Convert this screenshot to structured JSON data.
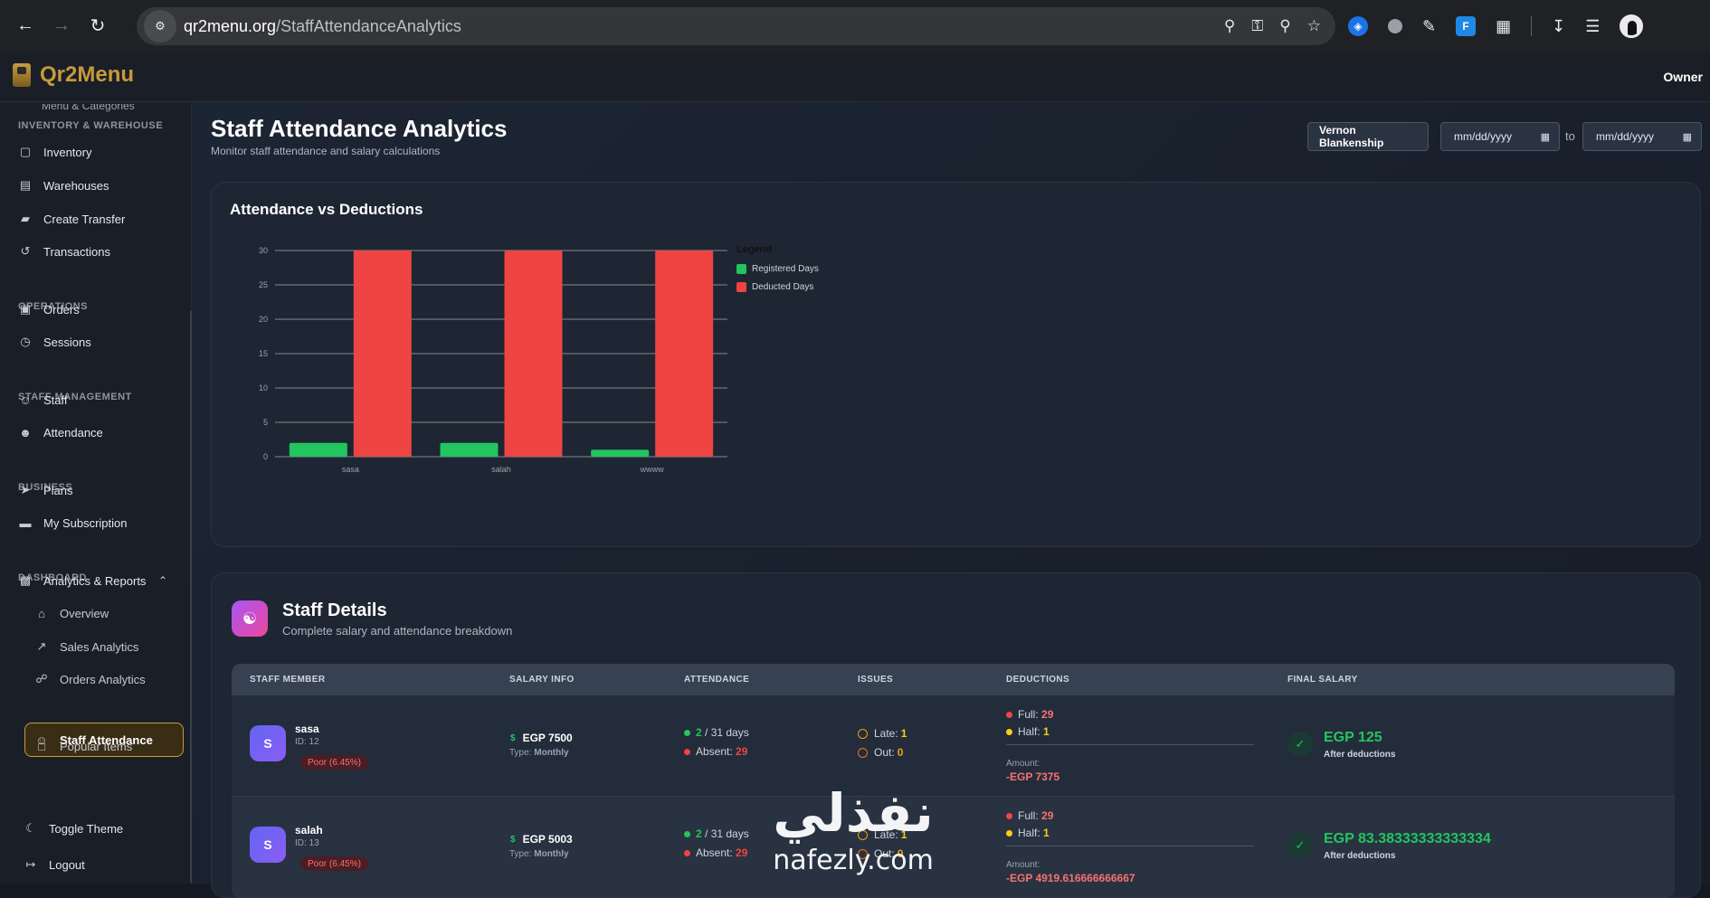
{
  "browser": {
    "url_host": "qr2menu.org",
    "url_path": "/StaffAttendanceAnalytics",
    "nav_icons": [
      "back-icon",
      "forward-icon",
      "reload-icon"
    ],
    "url_right_icons": [
      "location-icon",
      "key-icon",
      "zoom-icon",
      "star-icon"
    ],
    "extension_icons": [
      "tampermonkey-icon",
      "grey-extension-icon",
      "eyedropper-icon",
      "fl-extension-icon",
      "puzzle-icon",
      "download-icon",
      "media-queue-icon",
      "profile-avatar"
    ]
  },
  "app": {
    "brand": "Qr2Menu",
    "user": "Owner"
  },
  "sidebar": {
    "cut_item": "Menu & Categories",
    "sections": {
      "inventory": "INVENTORY & WAREHOUSE",
      "operations": "OPERATIONS",
      "staff": "STAFF MANAGEMENT",
      "business": "BUSINESS",
      "dashboard": "DASHBOARD"
    },
    "items": {
      "inventory": "Inventory",
      "warehouses": "Warehouses",
      "create_transfer": "Create Transfer",
      "transactions": "Transactions",
      "orders": "Orders",
      "sessions": "Sessions",
      "staff": "Staff",
      "attendance": "Attendance",
      "plans": "Plans",
      "my_subscription": "My Subscription",
      "analytics_reports": "Analytics & Reports"
    },
    "sub_items": {
      "overview": "Overview",
      "sales_analytics": "Sales Analytics",
      "orders_analytics": "Orders Analytics",
      "staff_attendance": "Staff Attendance",
      "popular_items": "Popular Items"
    },
    "toggle_theme": "Toggle Theme",
    "logout": "Logout"
  },
  "page": {
    "title": "Staff Attendance Analytics",
    "subtitle": "Monitor staff attendance and salary calculations",
    "staff_filter": "Vernon Blankenship",
    "date_from_placeholder": "mm/dd/yyyy",
    "date_to_placeholder": "mm/dd/yyyy",
    "to_label": "to"
  },
  "chart_card": {
    "title": "Attendance vs Deductions",
    "legend_title": "Legend"
  },
  "chart_data": {
    "type": "bar",
    "categories": [
      "sasa",
      "salah",
      "wwww"
    ],
    "series": [
      {
        "name": "Registered Days",
        "values": [
          2,
          2,
          1
        ],
        "color": "#22c55e"
      },
      {
        "name": "Deducted Days",
        "values": [
          30,
          30,
          30
        ],
        "color": "#ef4444"
      }
    ],
    "ylim": [
      0,
      30
    ],
    "yticks": [
      "0",
      "5",
      "10",
      "15",
      "20",
      "25",
      "30"
    ],
    "grid": true,
    "legend_position": "right"
  },
  "staff_details": {
    "title": "Staff Details",
    "subtitle": "Complete salary and attendance breakdown",
    "columns": [
      "STAFF MEMBER",
      "SALARY INFO",
      "ATTENDANCE",
      "ISSUES",
      "DEDUCTIONS",
      "FINAL SALARY"
    ],
    "rows": [
      {
        "initial": "S",
        "name": "sasa",
        "id": "ID: 12",
        "rating": "Poor (6.45%)",
        "salary": "EGP 7500",
        "type_label": "Type:",
        "type": "Monthly",
        "present": "2",
        "days_total": "/ 31 days",
        "absent_label": "Absent:",
        "absent": "29",
        "late_label": "Late:",
        "late": "1",
        "out_label": "Out:",
        "out": "0",
        "full_label": "Full:",
        "full": "29",
        "half_label": "Half:",
        "half": "1",
        "amount_label": "Amount:",
        "amount": "-EGP 7375",
        "final": "EGP 125",
        "final_sub": "After deductions"
      },
      {
        "initial": "S",
        "name": "salah",
        "id": "ID: 13",
        "rating": "Poor (6.45%)",
        "salary": "EGP 5003",
        "type_label": "Type:",
        "type": "Monthly",
        "present": "2",
        "days_total": "/ 31 days",
        "absent_label": "Absent:",
        "absent": "29",
        "late_label": "Late:",
        "late": "1",
        "out_label": "Out:",
        "out": "0",
        "full_label": "Full:",
        "full": "29",
        "half_label": "Half:",
        "half": "1",
        "amount_label": "Amount:",
        "amount": "-EGP 4919.616666666667",
        "final": "EGP 83.38333333333334",
        "final_sub": "After deductions"
      }
    ]
  },
  "watermark": {
    "arabic": "نفذلي",
    "latin": "nafezly.com"
  }
}
